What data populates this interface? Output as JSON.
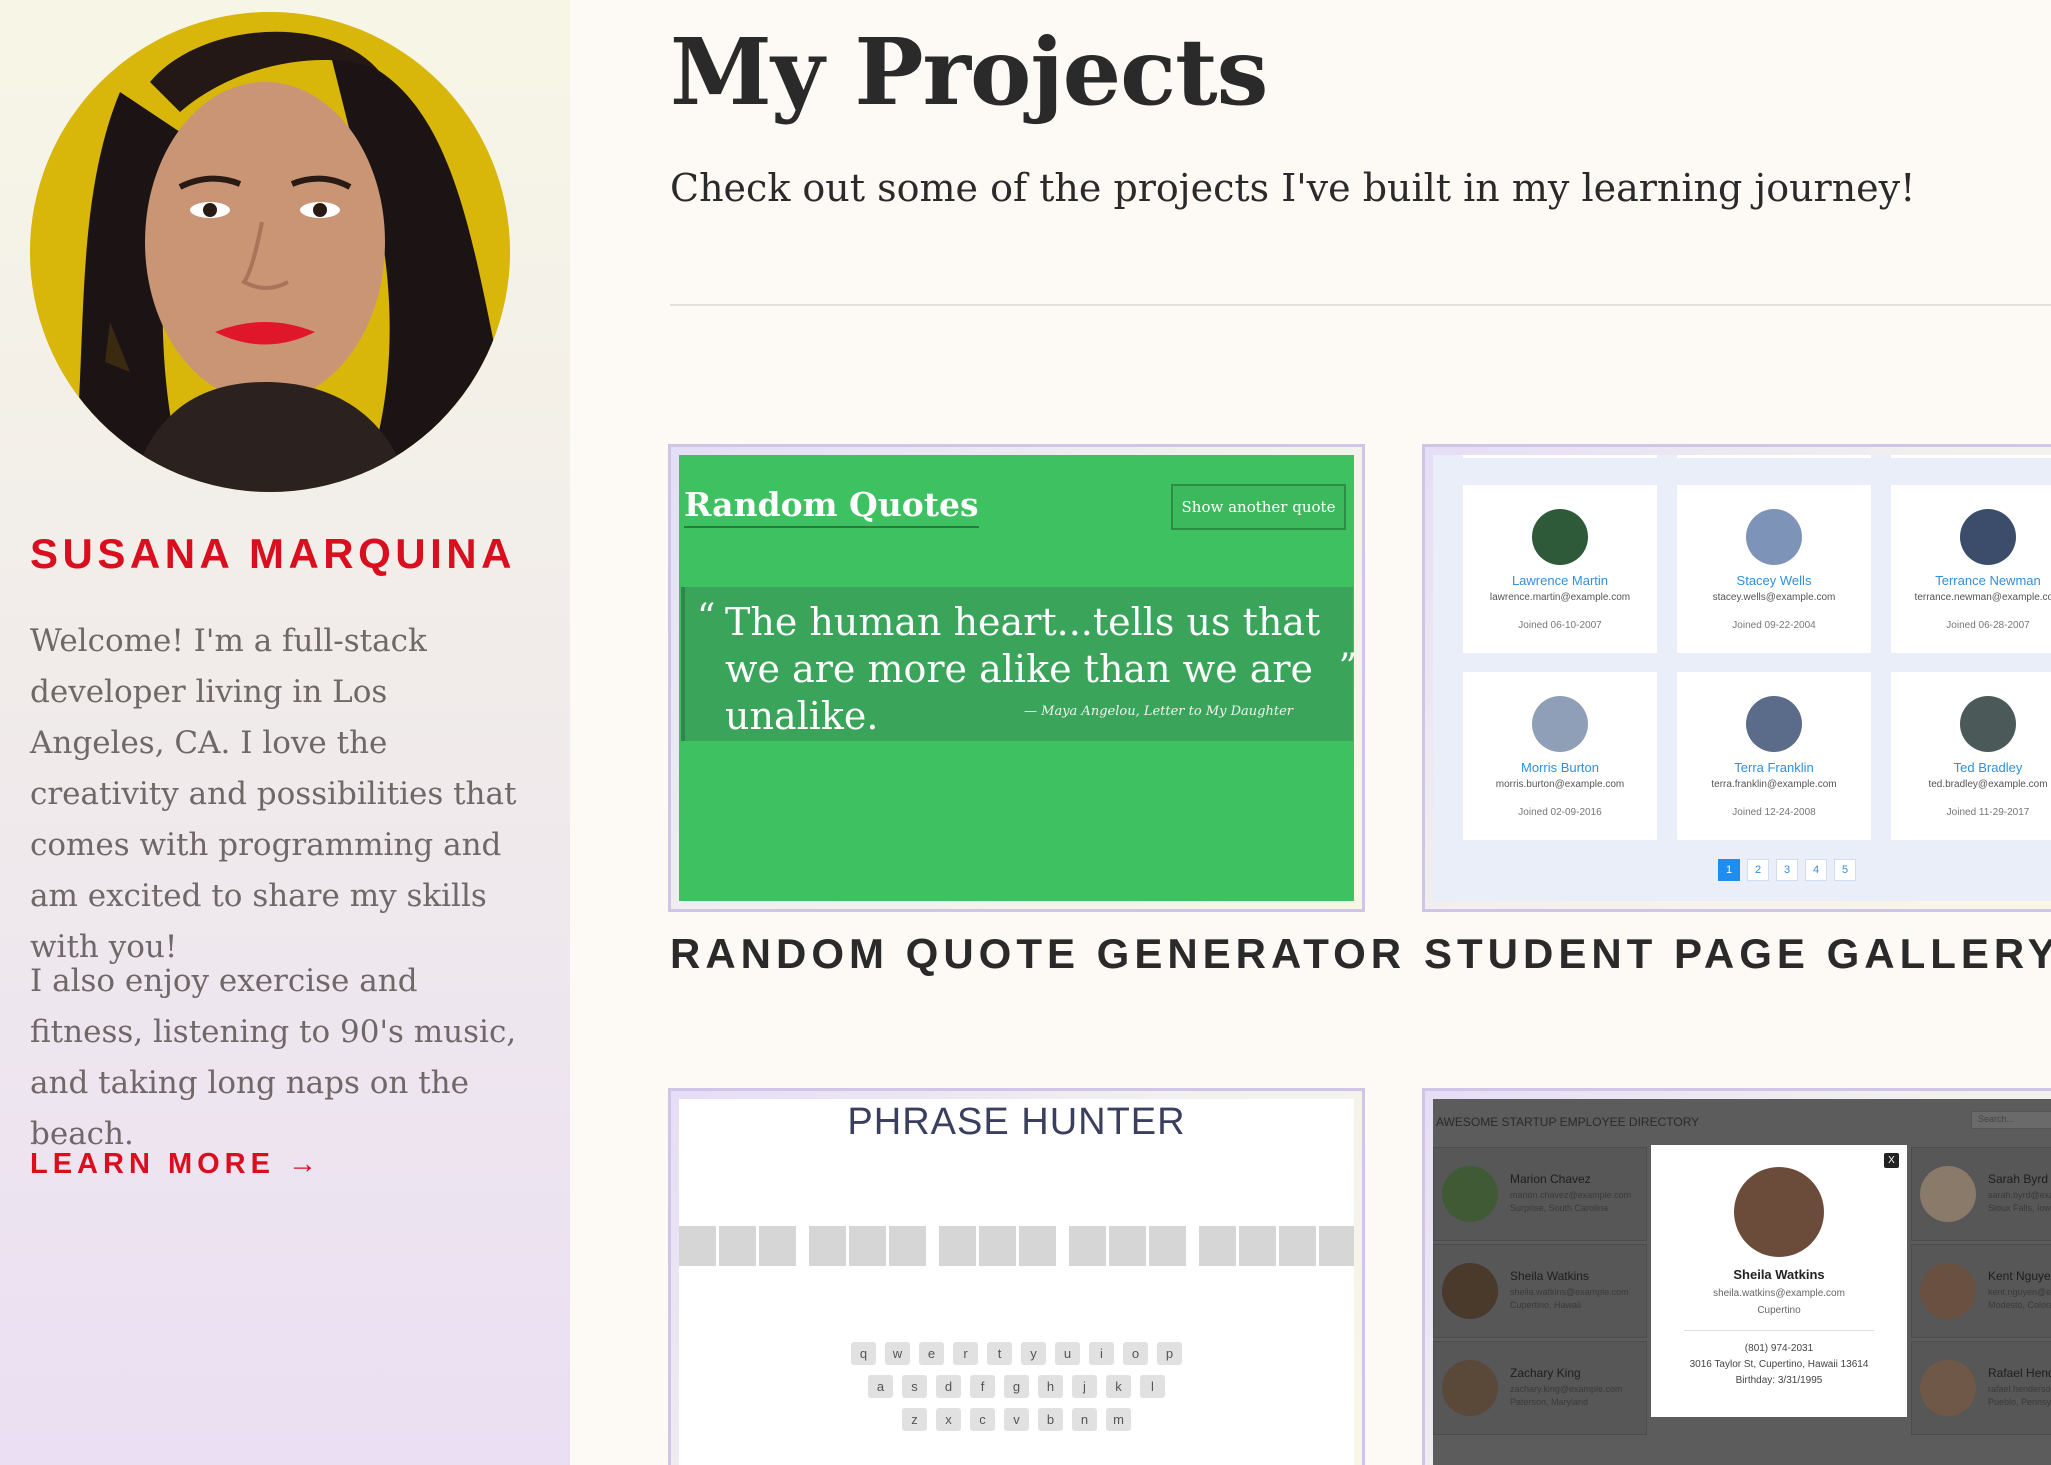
{
  "profile": {
    "name": "SUSANA MARQUINA",
    "bio_1": "Welcome! I'm a full-stack developer living in Los Angeles, CA. I love the creativity and possibilities that comes with programming and am excited to share my skills with you!",
    "bio_2": "I also enjoy exercise and fitness, listening to 90's music, and taking long naps on the beach.",
    "learn_more": "LEARN MORE →"
  },
  "main": {
    "title": "My Projects",
    "subtitle": "Check out some of the projects I've built in my learning journey!"
  },
  "projects": [
    {
      "label": "RANDOM QUOTE GENERATOR",
      "preview": {
        "title": "Random Quotes",
        "button": "Show another quote",
        "open_quote": "“",
        "close_quote": "”",
        "quote": "The human heart...tells us that we are more alike than we are unalike.",
        "attribution": "— Maya Angelou, Letter to My Daughter"
      }
    },
    {
      "label": "STUDENT PAGE GALLERY",
      "preview": {
        "students": [
          {
            "name": "Lawrence Martin",
            "email": "lawrence.martin@example.com",
            "joined": "Joined 06-10-2007"
          },
          {
            "name": "Stacey Wells",
            "email": "stacey.wells@example.com",
            "joined": "Joined 09-22-2004"
          },
          {
            "name": "Terrance Newman",
            "email": "terrance.newman@example.com",
            "joined": "Joined 06-28-2007"
          },
          {
            "name": "Morris Burton",
            "email": "morris.burton@example.com",
            "joined": "Joined 02-09-2016"
          },
          {
            "name": "Terra Franklin",
            "email": "terra.franklin@example.com",
            "joined": "Joined 12-24-2008"
          },
          {
            "name": "Ted Bradley",
            "email": "ted.bradley@example.com",
            "joined": "Joined 11-29-2017"
          }
        ],
        "pages": [
          "1",
          "2",
          "3",
          "4",
          "5"
        ]
      }
    },
    {
      "label": "",
      "preview": {
        "title": "PHRASE HUNTER",
        "keyboard_rows": [
          [
            "q",
            "w",
            "e",
            "r",
            "t",
            "y",
            "u",
            "i",
            "o",
            "p"
          ],
          [
            "a",
            "s",
            "d",
            "f",
            "g",
            "h",
            "j",
            "k",
            "l"
          ],
          [
            "z",
            "x",
            "c",
            "v",
            "b",
            "n",
            "m"
          ]
        ]
      }
    },
    {
      "label": "",
      "preview": {
        "header": "AWESOME STARTUP EMPLOYEE DIRECTORY",
        "search_placeholder": "Search...",
        "employees_left": [
          {
            "name": "Marion Chavez",
            "email": "marion.chavez@example.com",
            "location": "Surprise, South Carolina"
          },
          {
            "name": "Sheila Watkins",
            "email": "sheila.watkins@example.com",
            "location": "Cupertino, Hawaii"
          },
          {
            "name": "Zachary King",
            "email": "zachary.king@example.com",
            "location": "Paterson, Maryland"
          }
        ],
        "employees_right": [
          {
            "name": "Sarah Byrd",
            "email": "sarah.byrd@example.com",
            "location": "Sioux Falls, Iowa"
          },
          {
            "name": "Kent Nguyen",
            "email": "kent.nguyen@example.com",
            "location": "Modesto, Colorado"
          },
          {
            "name": "Rafael Henderson",
            "email": "rafael.henderson@example.com",
            "location": "Pueblo, Pennsylvania"
          }
        ],
        "modal": {
          "close": "X",
          "name": "Sheila Watkins",
          "email": "sheila.watkins@example.com",
          "city": "Cupertino",
          "phone": "(801) 974-2031",
          "address": "3016 Taylor St, Cupertino, Hawaii 13614",
          "birthday": "Birthday: 3/31/1995"
        }
      }
    }
  ]
}
